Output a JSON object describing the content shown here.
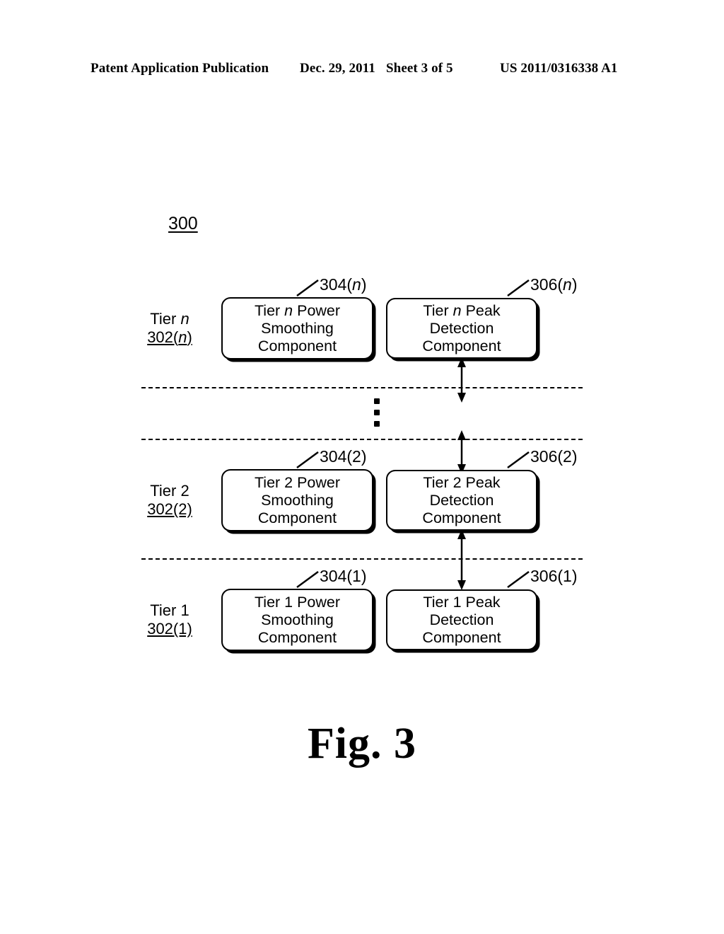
{
  "header": {
    "publication": "Patent Application Publication",
    "date": "Dec. 29, 2011",
    "sheet": "Sheet 3 of 5",
    "patent_number": "US 2011/0316338 A1"
  },
  "figure": {
    "caption": "Fig. 3",
    "reference_numeral": "300",
    "tiers": [
      {
        "label_name": "Tier n",
        "label_ref": "302(n)",
        "smoothing_callout": "304(n)",
        "smoothing_line1": "Tier n Power",
        "smoothing_line2": "Smoothing",
        "smoothing_line3": "Component",
        "peak_callout": "306(n)",
        "peak_line1": "Tier n Peak Detection",
        "peak_line2": "Component"
      },
      {
        "label_name": "Tier 2",
        "label_ref": "302(2)",
        "smoothing_callout": "304(2)",
        "smoothing_line1": "Tier 2 Power",
        "smoothing_line2": "Smoothing",
        "smoothing_line3": "Component",
        "peak_callout": "306(2)",
        "peak_line1": "Tier 2 Peak Detection",
        "peak_line2": "Component"
      },
      {
        "label_name": "Tier 1",
        "label_ref": "302(1)",
        "smoothing_callout": "304(1)",
        "smoothing_line1": "Tier 1 Power",
        "smoothing_line2": "Smoothing",
        "smoothing_line3": "Component",
        "peak_callout": "306(1)",
        "peak_line1": "Tier 1 Peak Detection",
        "peak_line2": "Component"
      }
    ],
    "ellipsis_symbol": "vertical-ellipsis-three-dots",
    "connectors": [
      "double-headed-arrow",
      "double-headed-arrow",
      "double-headed-arrow"
    ],
    "line_color": "#000000",
    "background_color": "#ffffff"
  }
}
